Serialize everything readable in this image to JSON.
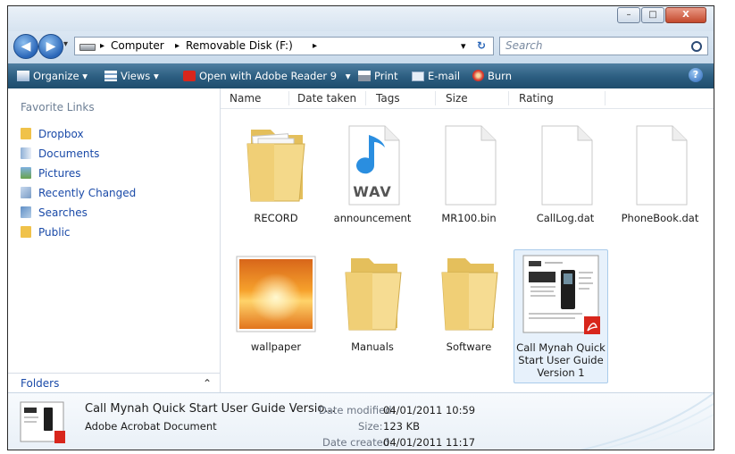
{
  "window": {
    "controls": {
      "minimize": "–",
      "maximize": "□",
      "close": "X"
    }
  },
  "nav": {
    "back": "◀",
    "forward": "▶",
    "history": "▾"
  },
  "address": {
    "segments": [
      "Computer",
      "Removable Disk (F:)"
    ],
    "separator": "▸",
    "refresh": "↻"
  },
  "search": {
    "placeholder": "Search"
  },
  "toolbar": {
    "organize": "Organize",
    "views": "Views",
    "open_with": "Open with Adobe Reader 9",
    "print": "Print",
    "email": "E-mail",
    "burn": "Burn",
    "help": "?",
    "dropdown": "▾"
  },
  "sidebar": {
    "title": "Favorite Links",
    "links": [
      {
        "label": "Dropbox",
        "icon": "dropbox-icon"
      },
      {
        "label": "Documents",
        "icon": "documents-icon"
      },
      {
        "label": "Pictures",
        "icon": "pictures-icon"
      },
      {
        "label": "Recently Changed",
        "icon": "recently-changed-icon"
      },
      {
        "label": "Searches",
        "icon": "searches-icon"
      },
      {
        "label": "Public",
        "icon": "public-folder-icon"
      }
    ],
    "folders_label": "Folders",
    "folders_toggle": "⌃"
  },
  "columns": [
    "Name",
    "Date taken",
    "Tags",
    "Size",
    "Rating"
  ],
  "files": [
    {
      "name": "RECORD",
      "type": "folder-with-files"
    },
    {
      "name": "announcement",
      "type": "wav"
    },
    {
      "name": "MR100.bin",
      "type": "blank"
    },
    {
      "name": "CallLog.dat",
      "type": "blank"
    },
    {
      "name": "PhoneBook.dat",
      "type": "blank"
    },
    {
      "name": "wallpaper",
      "type": "image"
    },
    {
      "name": "Manuals",
      "type": "folder"
    },
    {
      "name": "Software",
      "type": "folder"
    },
    {
      "name_lines": [
        "Call Mynah Quick",
        "Start User Guide",
        "Version 1"
      ],
      "type": "pdf",
      "selected": true
    }
  ],
  "wav_badge": "WAV",
  "details": {
    "name": "Call Mynah Quick Start User Guide Versio...",
    "type": "Adobe Acrobat Document",
    "date_modified_label": "Date modified:",
    "date_modified": "04/01/2011 10:59",
    "size_label": "Size:",
    "size": "123 KB",
    "date_created_label": "Date created:",
    "date_created": "04/01/2011 11:17"
  },
  "colors": {
    "toolbar": "#2b5d80",
    "link": "#1a4aa8",
    "selection": "#e7f1fb",
    "folder": "#f2d27a"
  }
}
